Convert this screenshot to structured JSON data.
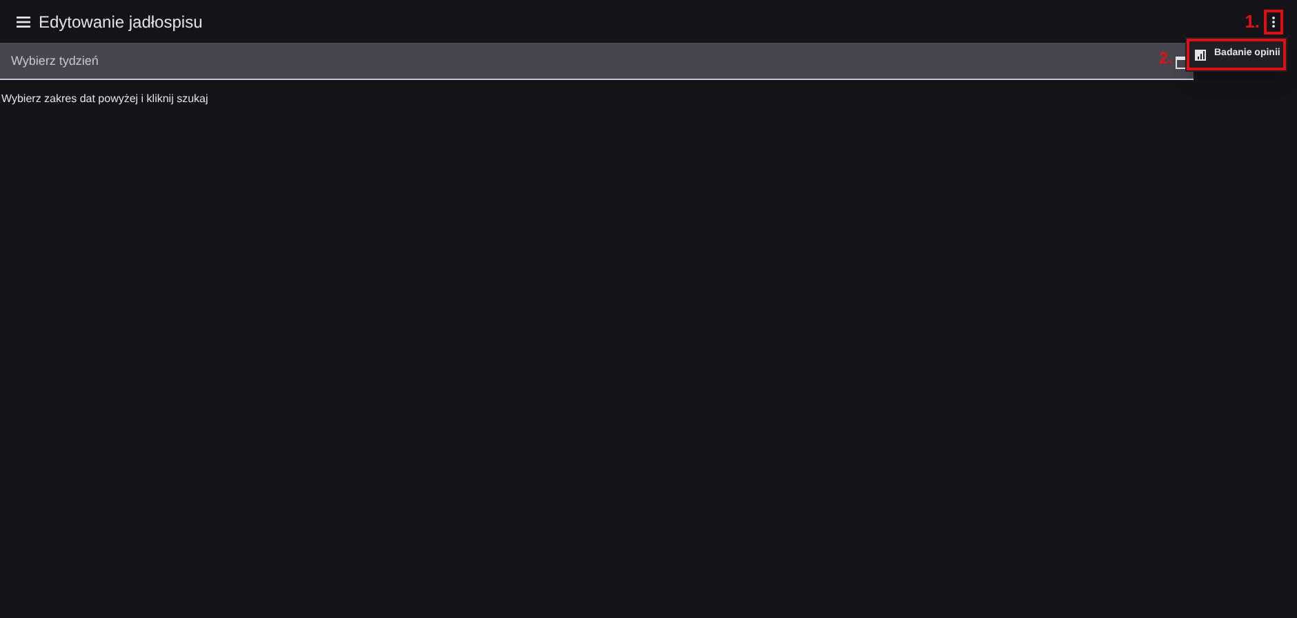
{
  "header": {
    "title": "Edytowanie jadłospisu"
  },
  "week_field": {
    "placeholder": "Wybierz tydzień"
  },
  "hint": "Wybierz zakres dat powyżej i kliknij szukaj",
  "menu": {
    "items": [
      {
        "label": "Badanie opinii"
      }
    ]
  },
  "annotations": [
    {
      "label": "1."
    },
    {
      "label": "2."
    }
  ]
}
